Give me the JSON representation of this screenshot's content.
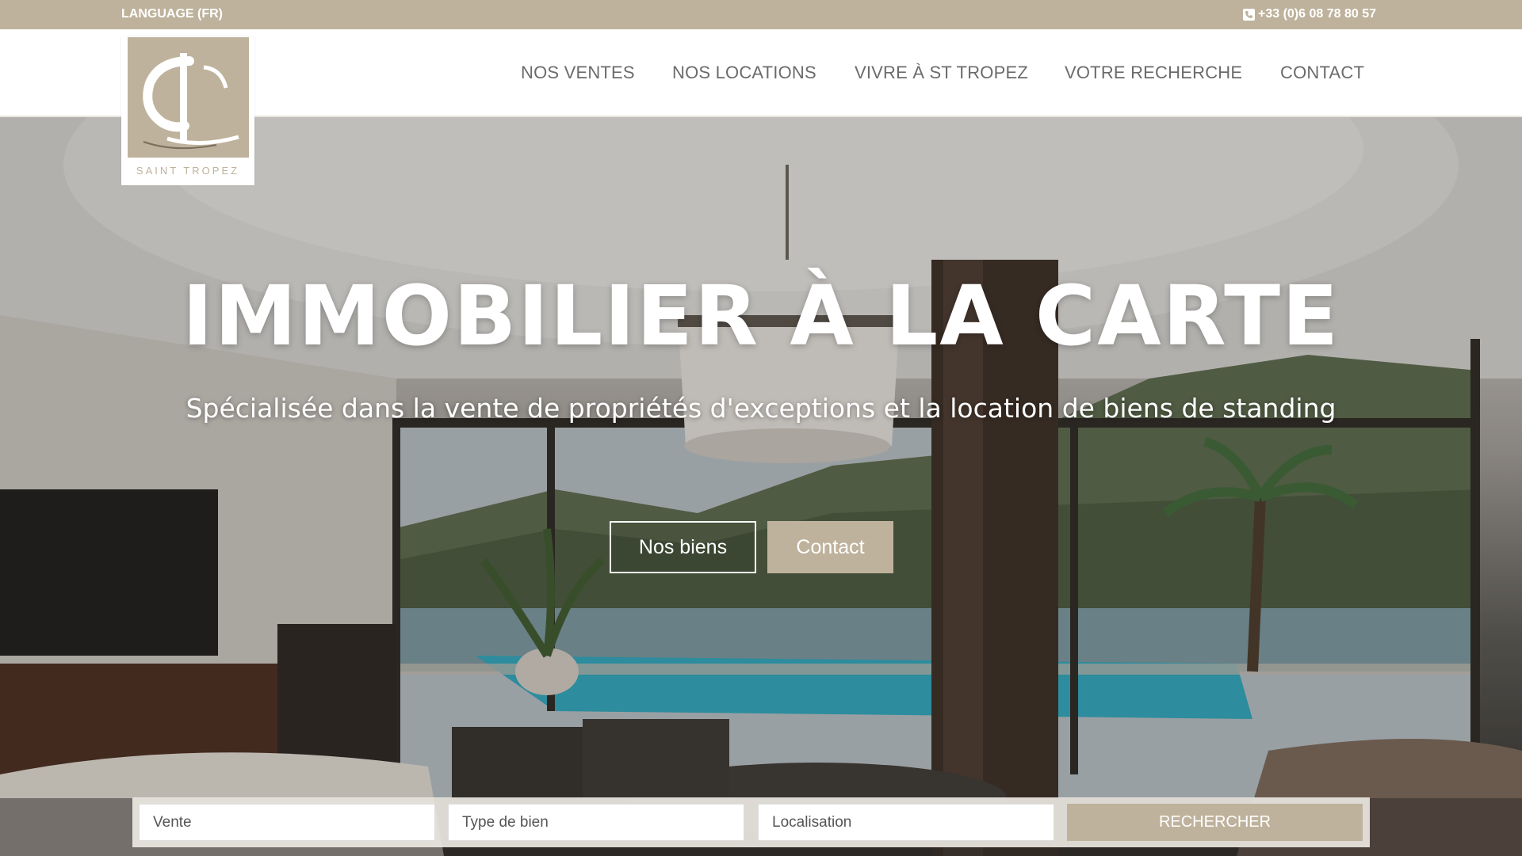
{
  "topbar": {
    "language": "LANGUAGE (FR)",
    "phone": "+33 (0)6 08 78 80 57",
    "phone_icon": "phone-icon"
  },
  "logo": {
    "tagline": "SAINT TROPEZ"
  },
  "nav": {
    "items": [
      "NOS VENTES",
      "NOS LOCATIONS",
      "VIVRE À ST TROPEZ",
      "VOTRE RECHERCHE",
      "CONTACT"
    ]
  },
  "hero": {
    "title": "IMMOBILIER À LA CARTE",
    "subtitle": "Spécialisée dans la vente de propriétés d'exceptions et la location de biens de standing",
    "primary_button": "Nos biens",
    "secondary_button": "Contact"
  },
  "search": {
    "transaction": "Vente",
    "property_type": "Type de bien",
    "location": "Localisation",
    "submit": "RECHERCHER"
  },
  "colors": {
    "accent": "#bfb29c",
    "nav_text": "#6b6b6b"
  }
}
